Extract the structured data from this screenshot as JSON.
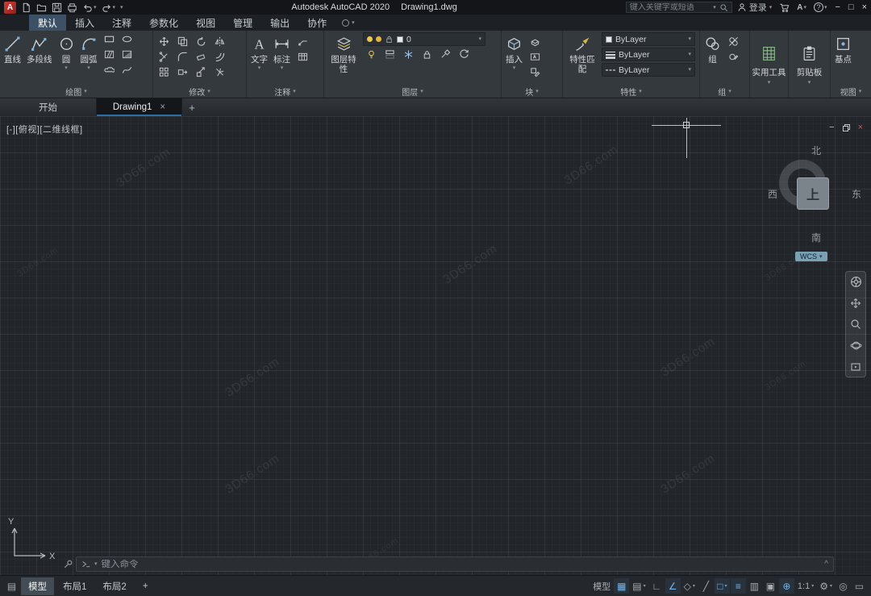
{
  "titlebar": {
    "logo": "A",
    "title": "Autodesk AutoCAD 2020",
    "doc_name": "Drawing1.dwg",
    "search_placeholder": "键入关键字或短语",
    "signin": "登录"
  },
  "ribbon_tabs": {
    "items": [
      "默认",
      "插入",
      "注释",
      "参数化",
      "视图",
      "管理",
      "输出",
      "协作"
    ]
  },
  "panels": {
    "draw": {
      "label": "绘图",
      "line": "直线",
      "polyline": "多段线",
      "circle": "圆",
      "arc": "圆弧"
    },
    "modify": {
      "label": "修改"
    },
    "annotation": {
      "label": "注释",
      "text": "文字",
      "dimension": "标注"
    },
    "layers": {
      "label": "图层",
      "layer_properties": "图层特性",
      "current_layer": "0"
    },
    "block": {
      "label": "块",
      "insert": "插入"
    },
    "properties": {
      "label": "特性",
      "match_properties": "特性匹配",
      "object_color": "ByLayer",
      "lineweight": "ByLayer",
      "linetype": "ByLayer"
    },
    "groups": {
      "label": "组",
      "group": "组"
    },
    "utilities": {
      "label": "实用工具"
    },
    "clipboard": {
      "label": "剪贴板"
    },
    "view": {
      "label": "视图",
      "base": "基点"
    }
  },
  "file_tabs": {
    "start": "开始",
    "drawing": "Drawing1",
    "close": "×",
    "add": "+"
  },
  "viewport": {
    "controls": "[-][俯视][二维线框]",
    "viewcube": {
      "north": "北",
      "south": "南",
      "west": "西",
      "east": "东",
      "top": "上",
      "wcs": "WCS"
    },
    "watermark": "3D66.com",
    "command_placeholder": "键入命令"
  },
  "statusbar": {
    "model_tab": "模型",
    "layout1_tab": "布局1",
    "layout2_tab": "布局2",
    "add_layout": "+",
    "model_space": "模型",
    "scale": "1:1"
  }
}
